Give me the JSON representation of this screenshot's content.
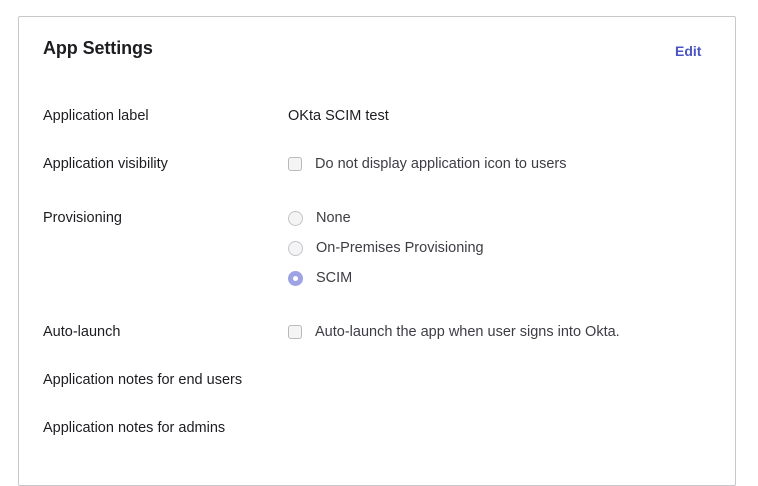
{
  "panel": {
    "title": "App Settings",
    "edit_label": "Edit"
  },
  "fields": {
    "app_label": {
      "label": "Application label",
      "value": "OKta SCIM test"
    },
    "visibility": {
      "label": "Application visibility",
      "option_label": "Do not display application icon to users",
      "checked": false
    },
    "provisioning": {
      "label": "Provisioning",
      "options": [
        {
          "label": "None",
          "selected": false
        },
        {
          "label": "On-Premises Provisioning",
          "selected": false
        },
        {
          "label": "SCIM",
          "selected": true
        }
      ]
    },
    "auto_launch": {
      "label": "Auto-launch",
      "option_label": "Auto-launch the app when user signs into Okta.",
      "checked": false
    },
    "notes_end_users": {
      "label": "Application notes for end users",
      "value": ""
    },
    "notes_admins": {
      "label": "Application notes for admins",
      "value": ""
    }
  },
  "colors": {
    "accent": "#4b55c2",
    "radio_selected": "#9ea3e6",
    "border": "#c8c8cc"
  }
}
